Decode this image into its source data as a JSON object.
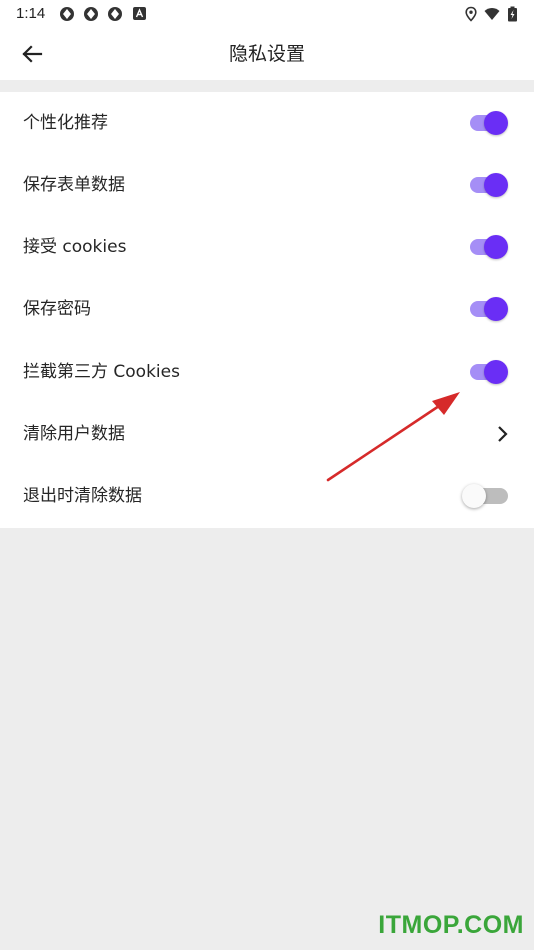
{
  "status_bar": {
    "time": "1:14",
    "icons": [
      "app-icon",
      "app-icon",
      "app-icon",
      "accessibility-icon",
      "location-icon",
      "wifi-icon",
      "battery-icon"
    ]
  },
  "app_bar": {
    "title": "隐私设置",
    "back_icon": "arrow-left-icon"
  },
  "settings": [
    {
      "label": "个性化推荐",
      "control": "switch",
      "enabled": true
    },
    {
      "label": "保存表单数据",
      "control": "switch",
      "enabled": true
    },
    {
      "label": "接受 cookies",
      "control": "switch",
      "enabled": true
    },
    {
      "label": "保存密码",
      "control": "switch",
      "enabled": true
    },
    {
      "label": "拦截第三方 Cookies",
      "control": "switch",
      "enabled": true
    },
    {
      "label": "清除用户数据",
      "control": "chevron"
    },
    {
      "label": "退出时清除数据",
      "control": "switch",
      "enabled": false
    }
  ],
  "colors": {
    "accent": "#6a2ef5",
    "accent_track": "#a58ef6",
    "annotation_arrow": "#d62a2a",
    "watermark": "#3aa63a",
    "background": "#ededed"
  },
  "watermark": "ITMOP.COM"
}
